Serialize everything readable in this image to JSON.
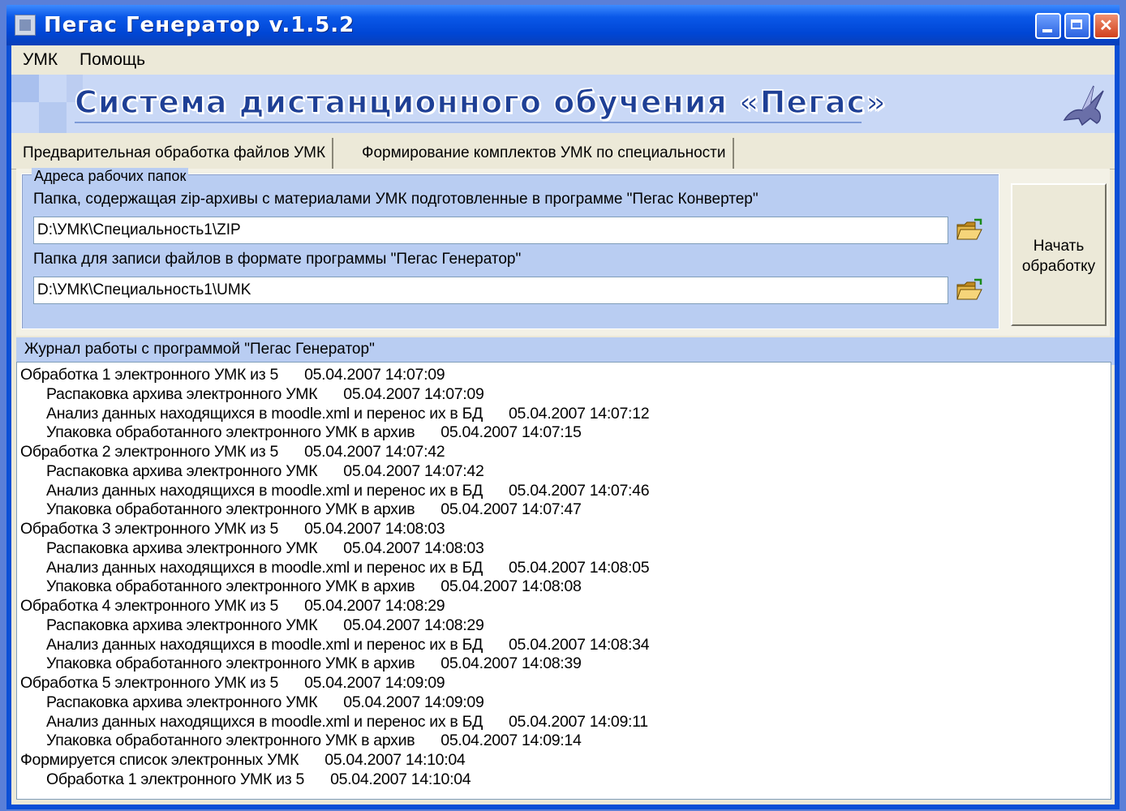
{
  "window": {
    "title": "Пегас Генератор v.1.5.2"
  },
  "menu": {
    "items": [
      "УМК",
      "Помощь"
    ]
  },
  "banner": {
    "title": "Система дистанционного обучения «Пегас»"
  },
  "tabs": [
    {
      "label": "Предварительная обработка файлов УМК",
      "active": true
    },
    {
      "label": "Формирование комплектов УМК по специальности",
      "active": false
    }
  ],
  "folders": {
    "group_label": "Адреса рабочих папок",
    "source_label": "Папка, содержащая zip-архивы с материалами УМК подготовленные в программе \"Пегас Конвертер\"",
    "source_value": "D:\\УМК\\Специальность1\\ZIP",
    "target_label": "Папка для записи файлов в формате программы \"Пегас Генератор\"",
    "target_value": "D:\\УМК\\Специальность1\\UMK"
  },
  "start_button": {
    "line1": "Начать",
    "line2": "обработку"
  },
  "log": {
    "label": "Журнал работы с программой \"Пегас Генератор\"",
    "entries": [
      {
        "level": 0,
        "text": "Обработка 1 электронного УМК из 5",
        "time": "05.04.2007 14:07:09"
      },
      {
        "level": 1,
        "text": "Распаковка архива электронного УМК",
        "time": "05.04.2007 14:07:09"
      },
      {
        "level": 1,
        "text": "Анализ данных находящихся в moodle.xml и перенос их в БД",
        "time": "05.04.2007 14:07:12"
      },
      {
        "level": 1,
        "text": "Упаковка обработанного электронного УМК в архив",
        "time": "05.04.2007 14:07:15"
      },
      {
        "level": 0,
        "text": "Обработка 2 электронного УМК из 5",
        "time": "05.04.2007 14:07:42"
      },
      {
        "level": 1,
        "text": "Распаковка архива электронного УМК",
        "time": "05.04.2007 14:07:42"
      },
      {
        "level": 1,
        "text": "Анализ данных находящихся в moodle.xml и перенос их в БД",
        "time": "05.04.2007 14:07:46"
      },
      {
        "level": 1,
        "text": "Упаковка обработанного электронного УМК в архив",
        "time": "05.04.2007 14:07:47"
      },
      {
        "level": 0,
        "text": "Обработка 3 электронного УМК из 5",
        "time": "05.04.2007 14:08:03"
      },
      {
        "level": 1,
        "text": "Распаковка архива электронного УМК",
        "time": "05.04.2007 14:08:03"
      },
      {
        "level": 1,
        "text": "Анализ данных находящихся в moodle.xml и перенос их в БД",
        "time": "05.04.2007 14:08:05"
      },
      {
        "level": 1,
        "text": "Упаковка обработанного электронного УМК в архив",
        "time": "05.04.2007 14:08:08"
      },
      {
        "level": 0,
        "text": "Обработка 4 электронного УМК из 5",
        "time": "05.04.2007 14:08:29"
      },
      {
        "level": 1,
        "text": "Распаковка архива электронного УМК",
        "time": "05.04.2007 14:08:29"
      },
      {
        "level": 1,
        "text": "Анализ данных находящихся в moodle.xml и перенос их в БД",
        "time": "05.04.2007 14:08:34"
      },
      {
        "level": 1,
        "text": "Упаковка обработанного электронного УМК в архив",
        "time": "05.04.2007 14:08:39"
      },
      {
        "level": 0,
        "text": "Обработка 5 электронного УМК из 5",
        "time": "05.04.2007 14:09:09"
      },
      {
        "level": 1,
        "text": "Распаковка архива электронного УМК",
        "time": "05.04.2007 14:09:09"
      },
      {
        "level": 1,
        "text": "Анализ данных находящихся в moodle.xml и перенос их в БД",
        "time": "05.04.2007 14:09:11"
      },
      {
        "level": 1,
        "text": "Упаковка обработанного электронного УМК в архив",
        "time": "05.04.2007 14:09:14"
      },
      {
        "level": 0,
        "text": "Формируется список электронных УМК",
        "time": "05.04.2007 14:10:04"
      },
      {
        "level": 1,
        "text": "Обработка 1 электронного УМК из 5",
        "time": "05.04.2007 14:10:04"
      }
    ]
  },
  "icons": {
    "app": "app-window-icon",
    "folder": "open-folder-icon",
    "logo": "pegasus-logo-icon"
  },
  "colors": {
    "titlebar": "#0a58e8",
    "banner": "#c9d8f6",
    "banner_text": "#1e3f95",
    "groupbox": "#b9cdf2",
    "face": "#ece9d8"
  }
}
